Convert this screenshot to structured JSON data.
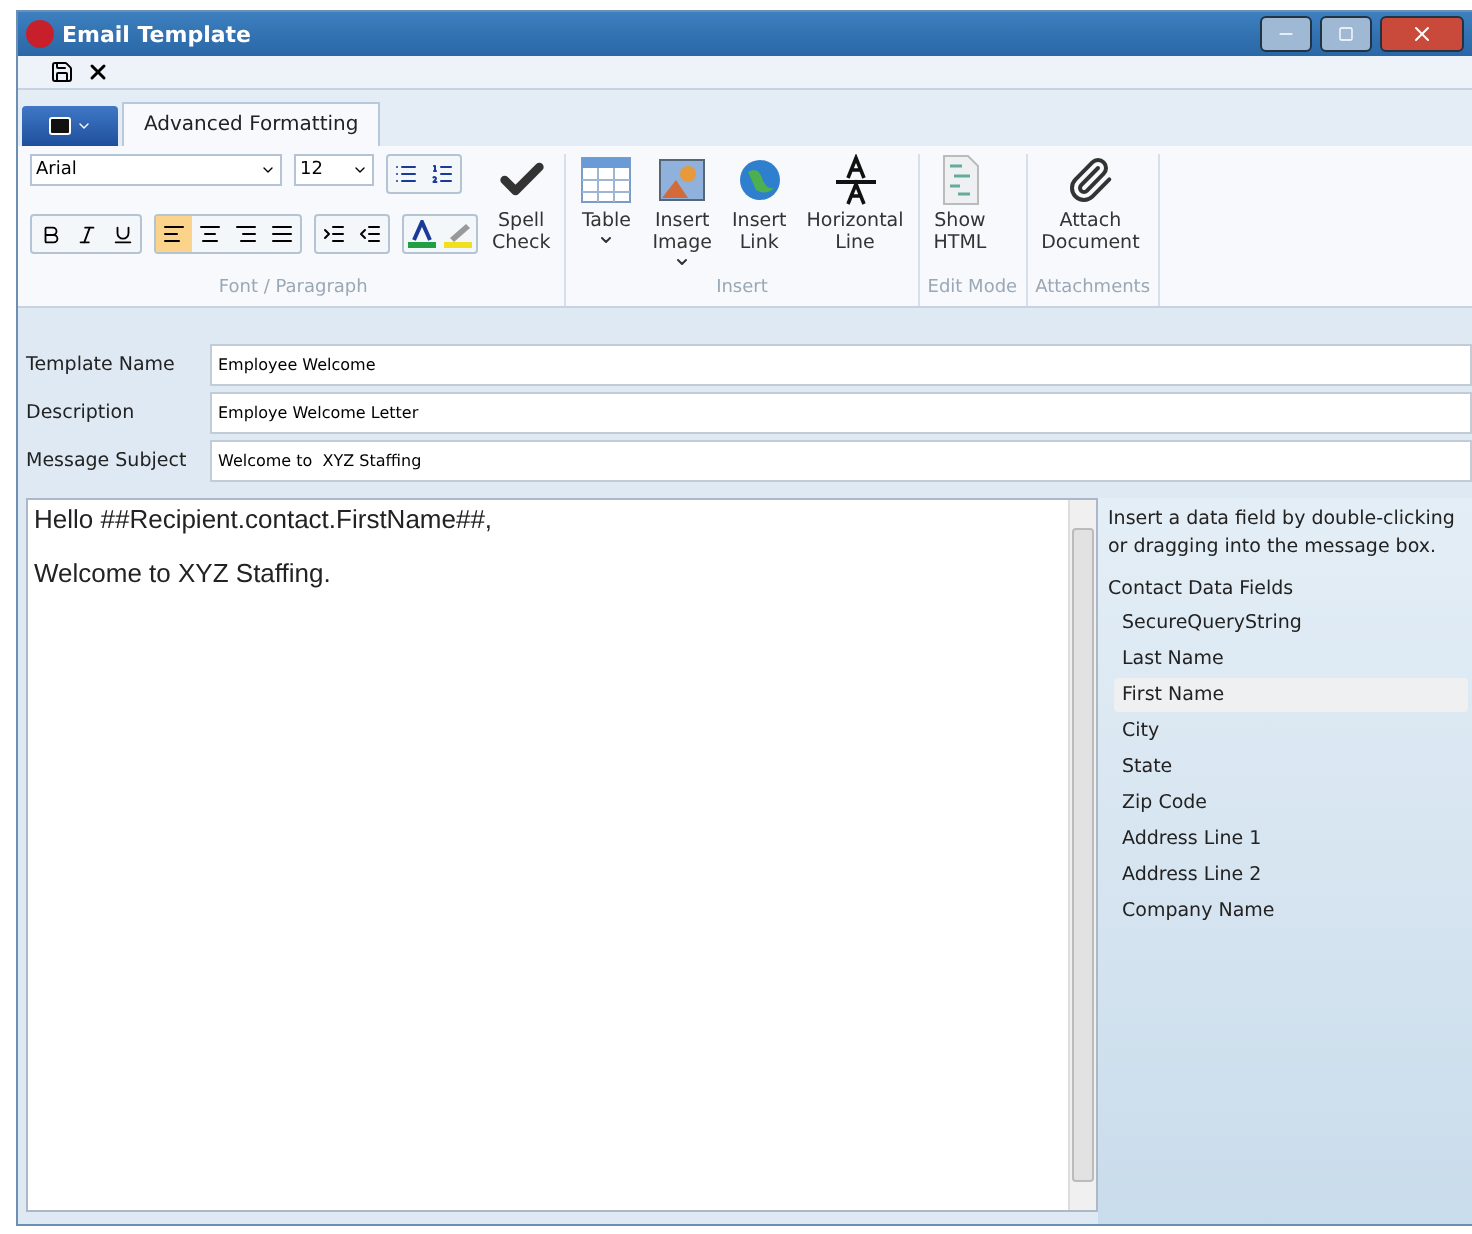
{
  "window": {
    "title": "Email Template"
  },
  "tabs": [
    {
      "label": "Advanced Formatting",
      "selected": true
    }
  ],
  "ribbon": {
    "font": "Arial",
    "size": "12",
    "alignments": [
      {
        "selected": true
      },
      {
        "selected": false
      },
      {
        "selected": false
      },
      {
        "selected": false
      }
    ],
    "groups": [
      {
        "label": "Font / Paragraph",
        "buttons": [
          {
            "kind": "spell",
            "lines": [
              "Spell",
              "Check"
            ]
          }
        ]
      },
      {
        "label": "Insert",
        "buttons": [
          {
            "kind": "table",
            "lines": [
              "Table"
            ],
            "dropdown": true
          },
          {
            "kind": "image",
            "lines": [
              "Insert",
              "Image"
            ],
            "dropdown": true
          },
          {
            "kind": "link",
            "lines": [
              "Insert",
              "Link"
            ],
            "dropdown": false
          },
          {
            "kind": "hline",
            "lines": [
              "Horizontal",
              "Line"
            ],
            "dropdown": false
          }
        ]
      },
      {
        "label": "Edit Mode",
        "buttons": [
          {
            "kind": "html",
            "lines": [
              "Show",
              "HTML"
            ],
            "dropdown": false
          }
        ]
      },
      {
        "label": "Attachments",
        "buttons": [
          {
            "kind": "attach",
            "lines": [
              "Attach",
              "Document"
            ],
            "dropdown": false
          }
        ]
      }
    ]
  },
  "fields": [
    {
      "label": "Template Name",
      "value": "Employee Welcome"
    },
    {
      "label": "Description",
      "value": "Employe Welcome Letter"
    },
    {
      "label": "Message Subject",
      "value": "Welcome to  XYZ Staffing"
    }
  ],
  "message": [
    "Hello ##Recipient.contact.FirstName##,",
    "Welcome to XYZ Staffing."
  ],
  "data_panel": {
    "hint": "Insert a data field by double-clicking or dragging into the message box.",
    "heading": "Contact Data Fields",
    "items": [
      {
        "label": "SecureQueryString",
        "selected": false
      },
      {
        "label": "Last Name",
        "selected": false
      },
      {
        "label": "First Name",
        "selected": true
      },
      {
        "label": "City",
        "selected": false
      },
      {
        "label": "State",
        "selected": false
      },
      {
        "label": "Zip Code",
        "selected": false
      },
      {
        "label": "Address Line 1",
        "selected": false
      },
      {
        "label": "Address Line 2",
        "selected": false
      },
      {
        "label": "Company Name",
        "selected": false
      }
    ]
  }
}
